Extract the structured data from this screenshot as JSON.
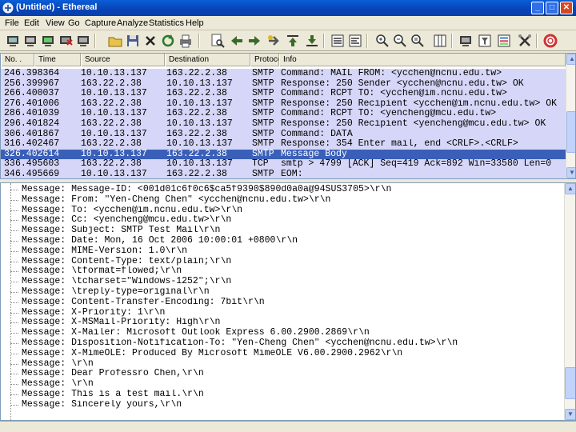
{
  "window": {
    "title": "(Untitled) - Ethereal",
    "minimize_label": "_",
    "maximize_label": "□",
    "close_label": "✕"
  },
  "menu": [
    "File",
    "Edit",
    "View",
    "Go",
    "Capture",
    "Analyze",
    "Statistics",
    "Help"
  ],
  "toolbar": {
    "buttons": [
      "list-interfaces-icon",
      "capture-options-icon",
      "start-capture-icon",
      "stop-capture-icon",
      "open-file-icon",
      "save-icon",
      "close-file-icon",
      "reload-icon",
      "print-icon",
      "find-packet-icon",
      "go-back-icon",
      "go-forward-icon",
      "go-to-packet-icon",
      "go-first-icon",
      "go-last-icon",
      "colorize-icon",
      "auto-scroll-icon",
      "zoom-in-icon",
      "zoom-out-icon",
      "zoom-normal-icon",
      "resize-columns-icon",
      "capture-filters-icon",
      "display-filters-icon",
      "coloring-rules-icon",
      "preferences-icon",
      "help-icon"
    ]
  },
  "packet_list": {
    "columns": [
      "No. .",
      "Time",
      "Source",
      "Destination",
      "Protocol",
      "Info"
    ],
    "rows": [
      {
        "no": "24",
        "time": "6.398364",
        "source": "10.10.13.137",
        "destination": "163.22.2.38",
        "protocol": "SMTP",
        "info": "Command: MAIL FROM: <ycchen@ncnu.edu.tw>"
      },
      {
        "no": "25",
        "time": "6.399967",
        "source": "163.22.2.38",
        "destination": "10.10.13.137",
        "protocol": "SMTP",
        "info": "Response: 250 Sender <ycchen@ncnu.edu.tw> OK"
      },
      {
        "no": "26",
        "time": "6.400037",
        "source": "10.10.13.137",
        "destination": "163.22.2.38",
        "protocol": "SMTP",
        "info": "Command: RCPT TO: <ycchen@im.ncnu.edu.tw>"
      },
      {
        "no": "27",
        "time": "6.401006",
        "source": "163.22.2.38",
        "destination": "10.10.13.137",
        "protocol": "SMTP",
        "info": "Response: 250 Recipient <ycchen@im.ncnu.edu.tw> OK"
      },
      {
        "no": "28",
        "time": "6.401039",
        "source": "10.10.13.137",
        "destination": "163.22.2.38",
        "protocol": "SMTP",
        "info": "Command: RCPT TO: <yencheng@mcu.edu.tw>"
      },
      {
        "no": "29",
        "time": "6.401824",
        "source": "163.22.2.38",
        "destination": "10.10.13.137",
        "protocol": "SMTP",
        "info": "Response: 250 Recipient <yencheng@mcu.edu.tw> OK"
      },
      {
        "no": "30",
        "time": "6.401867",
        "source": "10.10.13.137",
        "destination": "163.22.2.38",
        "protocol": "SMTP",
        "info": "Command: DATA"
      },
      {
        "no": "31",
        "time": "6.402467",
        "source": "163.22.2.38",
        "destination": "10.10.13.137",
        "protocol": "SMTP",
        "info": "Response: 354 Enter mail, end <CRLF>.<CRLF>"
      },
      {
        "no": "32",
        "time": "6.402614",
        "source": "10.10.13.137",
        "destination": "163.22.2.38",
        "protocol": "SMTP",
        "info": "Message Body"
      },
      {
        "no": "33",
        "time": "6.495603",
        "source": "163.22.2.38",
        "destination": "10.10.13.137",
        "protocol": "TCP",
        "info": "smtp > 4799 [ACK] Seq=419 Ack=892 Win=33580 Len=0"
      },
      {
        "no": "34",
        "time": "6.495669",
        "source": "10.10.13.137",
        "destination": "163.22.2.38",
        "protocol": "SMTP",
        "info": "EOM:"
      }
    ],
    "selected_index": 8
  },
  "detail": {
    "lines": [
      "Message: Message-ID: <001d01c6f0c6$ca5f9390$890d0a0a@94SUS3705>\\r\\n",
      "Message: From: \"Yen-Cheng Chen\" <ycchen@ncnu.edu.tw>\\r\\n",
      "Message: To: <ycchen@im.ncnu.edu.tw>\\r\\n",
      "Message: Cc: <yencheng@mcu.edu.tw>\\r\\n",
      "Message: Subject: SMTP Test Mail\\r\\n",
      "Message: Date: Mon, 16 Oct 2006 10:00:01 +0800\\r\\n",
      "Message: MIME-Version: 1.0\\r\\n",
      "Message: Content-Type: text/plain;\\r\\n",
      "Message: \\tformat=flowed;\\r\\n",
      "Message: \\tcharset=\"Windows-1252\";\\r\\n",
      "Message: \\treply-type=original\\r\\n",
      "Message: Content-Transfer-Encoding: 7bit\\r\\n",
      "Message: X-Priority: 1\\r\\n",
      "Message: X-MSMail-Priority: High\\r\\n",
      "Message: X-Mailer: Microsoft Outlook Express 6.00.2900.2869\\r\\n",
      "Message: Disposition-Notification-To: \"Yen-Cheng Chen\" <ycchen@ncnu.edu.tw>\\r\\n",
      "Message: X-MimeOLE: Produced By Microsoft MimeOLE V6.00.2900.2962\\r\\n",
      "Message: \\r\\n",
      "Message: Dear Professro Chen,\\r\\n",
      "Message: \\r\\n",
      "Message: This is a test mail.\\r\\n",
      "Message: Sincerely yours,\\r\\n"
    ]
  },
  "colors": {
    "title_bar": "#0a5ed8",
    "row_background": "#d6d6f8",
    "selected_row": "#3a5fb8"
  }
}
